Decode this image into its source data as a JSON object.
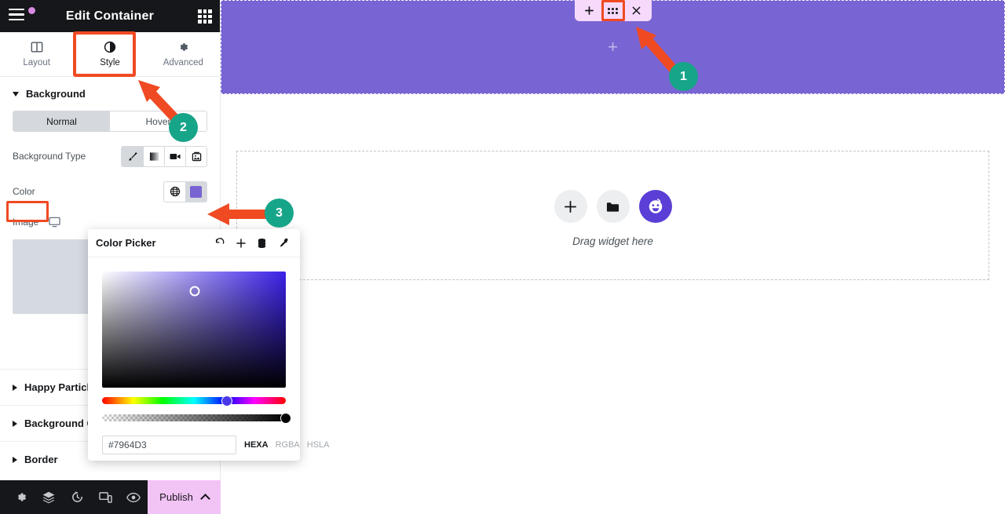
{
  "panel": {
    "header": {
      "title": "Edit Container",
      "menu_icon": "hamburger-menu-icon",
      "notification_dot": "notification-dot",
      "grid_icon": "apps-grid-icon"
    },
    "tabs": [
      {
        "label": "Layout",
        "icon": "layout-columns-icon",
        "active": false
      },
      {
        "label": "Style",
        "icon": "contrast-circle-icon",
        "active": true
      },
      {
        "label": "Advanced",
        "icon": "gear-icon",
        "active": false
      }
    ],
    "background_section": {
      "title": "Background",
      "expanded": true,
      "states": [
        {
          "label": "Normal",
          "active": true
        },
        {
          "label": "Hover",
          "active": false
        }
      ],
      "background_type": {
        "label": "Background Type",
        "options": [
          {
            "icon": "brush-icon",
            "active": true
          },
          {
            "icon": "gradient-icon",
            "active": false
          },
          {
            "icon": "video-camera-icon",
            "active": false
          },
          {
            "icon": "slideshow-icon",
            "active": false
          }
        ]
      },
      "color": {
        "label": "Color",
        "global_icon": "globe-icon",
        "swatch_hex": "#7964D3",
        "swatch_active": true
      },
      "image": {
        "label": "Image",
        "responsive_icon": "monitor-icon"
      }
    },
    "collapsed_sections": [
      {
        "label": "Happy Particles"
      },
      {
        "label": "Background Overlay"
      },
      {
        "label": "Border"
      }
    ],
    "footer": {
      "icons": [
        "settings-gear-icon",
        "navigator-layers-icon",
        "history-revisions-icon",
        "responsive-mode-icon",
        "preview-eye-icon"
      ],
      "publish_label": "Publish",
      "publish_chevron": "chevron-up-icon"
    }
  },
  "color_picker": {
    "title": "Color Picker",
    "actions": [
      "undo-reset-icon",
      "add-swatch-icon",
      "saved-colors-icon",
      "eyedropper-icon"
    ],
    "hex_value": "#7964D3",
    "modes": [
      {
        "label": "HEXA",
        "active": true
      },
      {
        "label": "RGBA",
        "active": false
      },
      {
        "label": "HSLA",
        "active": false
      }
    ]
  },
  "canvas": {
    "container": {
      "background_hex": "#7964D3",
      "add_plus_icon": "add-plus-icon",
      "toolbar": [
        {
          "icon": "plus-icon",
          "highlighted": false
        },
        {
          "icon": "grip-dots-icon",
          "highlighted": true
        },
        {
          "icon": "close-x-icon",
          "highlighted": false
        }
      ]
    },
    "drop_zone": {
      "text": "Drag widget here",
      "buttons": [
        {
          "icon": "plus-icon"
        },
        {
          "icon": "folder-icon"
        },
        {
          "icon": "ai-face-icon"
        }
      ]
    }
  },
  "annotations": {
    "accent_hex": "#F04A23",
    "badge_hex": "#17A589",
    "steps": [
      {
        "number": "1"
      },
      {
        "number": "2"
      },
      {
        "number": "3"
      }
    ]
  }
}
